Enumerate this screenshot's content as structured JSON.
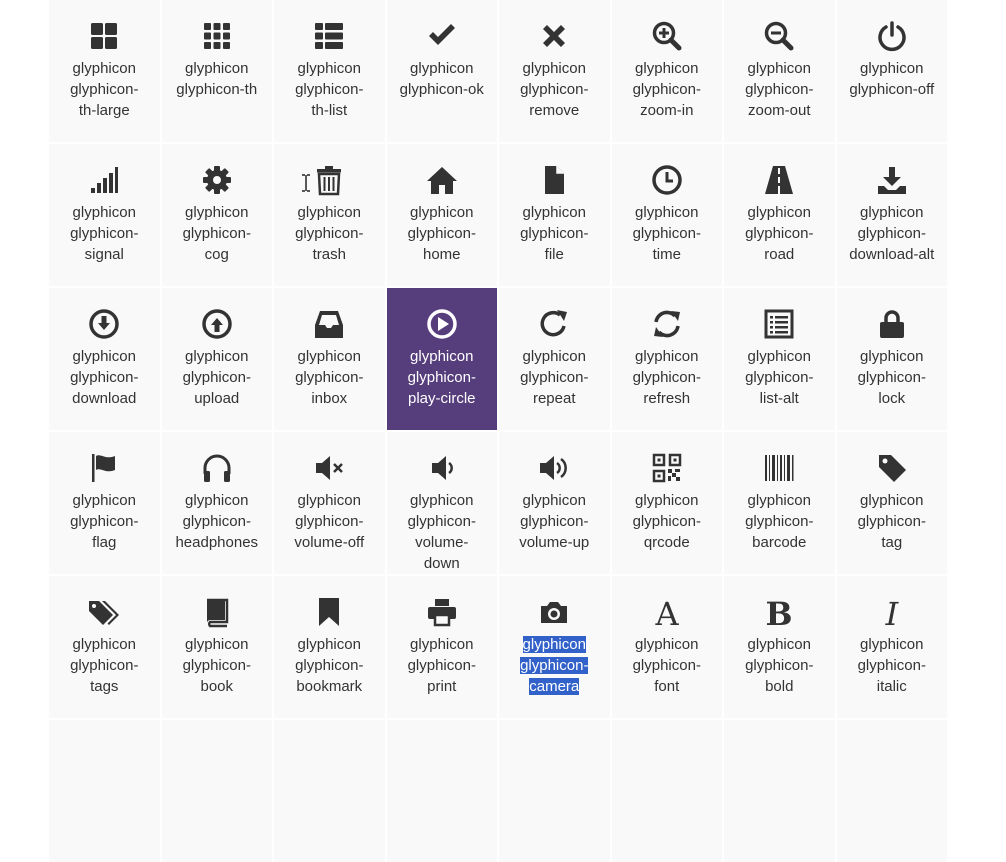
{
  "theme": {
    "cell_bg": "#f9f9f9",
    "text": "#333333",
    "active_bg": "#563d7c",
    "selection_bg": "#3161c9"
  },
  "icons": [
    {
      "icon": "th-large-icon",
      "line1": "glyphicon",
      "line2": "glyphicon-",
      "line3": "th-large"
    },
    {
      "icon": "th-icon",
      "line1": "glyphicon",
      "line2": "glyphicon-th",
      "line3": ""
    },
    {
      "icon": "th-list-icon",
      "line1": "glyphicon",
      "line2": "glyphicon-",
      "line3": "th-list"
    },
    {
      "icon": "ok-icon",
      "line1": "glyphicon",
      "line2": "glyphicon-ok",
      "line3": ""
    },
    {
      "icon": "remove-icon",
      "line1": "glyphicon",
      "line2": "glyphicon-",
      "line3": "remove"
    },
    {
      "icon": "zoom-in-icon",
      "line1": "glyphicon",
      "line2": "glyphicon-",
      "line3": "zoom-in"
    },
    {
      "icon": "zoom-out-icon",
      "line1": "glyphicon",
      "line2": "glyphicon-",
      "line3": "zoom-out"
    },
    {
      "icon": "off-icon",
      "line1": "glyphicon",
      "line2": "glyphicon-off",
      "line3": ""
    },
    {
      "icon": "signal-icon",
      "line1": "glyphicon",
      "line2": "glyphicon-",
      "line3": "signal"
    },
    {
      "icon": "cog-icon",
      "line1": "glyphicon",
      "line2": "glyphicon-",
      "line3": "cog"
    },
    {
      "icon": "trash-icon",
      "line1": "glyphicon",
      "line2": "glyphicon-",
      "line3": "trash"
    },
    {
      "icon": "home-icon",
      "line1": "glyphicon",
      "line2": "glyphicon-",
      "line3": "home"
    },
    {
      "icon": "file-icon",
      "line1": "glyphicon",
      "line2": "glyphicon-",
      "line3": "file"
    },
    {
      "icon": "time-icon",
      "line1": "glyphicon",
      "line2": "glyphicon-",
      "line3": "time"
    },
    {
      "icon": "road-icon",
      "line1": "glyphicon",
      "line2": "glyphicon-",
      "line3": "road"
    },
    {
      "icon": "download-alt-icon",
      "line1": "glyphicon",
      "line2": "glyphicon-",
      "line3": "download-alt"
    },
    {
      "icon": "download-icon",
      "line1": "glyphicon",
      "line2": "glyphicon-",
      "line3": "download"
    },
    {
      "icon": "upload-icon",
      "line1": "glyphicon",
      "line2": "glyphicon-",
      "line3": "upload"
    },
    {
      "icon": "inbox-icon",
      "line1": "glyphicon",
      "line2": "glyphicon-",
      "line3": "inbox"
    },
    {
      "icon": "play-circle-icon",
      "line1": "glyphicon",
      "line2": "glyphicon-",
      "line3": "play-circle"
    },
    {
      "icon": "repeat-icon",
      "line1": "glyphicon",
      "line2": "glyphicon-",
      "line3": "repeat"
    },
    {
      "icon": "refresh-icon",
      "line1": "glyphicon",
      "line2": "glyphicon-",
      "line3": "refresh"
    },
    {
      "icon": "list-alt-icon",
      "line1": "glyphicon",
      "line2": "glyphicon-",
      "line3": "list-alt"
    },
    {
      "icon": "lock-icon",
      "line1": "glyphicon",
      "line2": "glyphicon-",
      "line3": "lock"
    },
    {
      "icon": "flag-icon",
      "line1": "glyphicon",
      "line2": "glyphicon-",
      "line3": "flag"
    },
    {
      "icon": "headphones-icon",
      "line1": "glyphicon",
      "line2": "glyphicon-",
      "line3": "headphones"
    },
    {
      "icon": "volume-off-icon",
      "line1": "glyphicon",
      "line2": "glyphicon-",
      "line3": "volume-off"
    },
    {
      "icon": "volume-down-icon",
      "line1": "glyphicon",
      "line2": "glyphicon-",
      "line3": "volume-",
      "line4": "down"
    },
    {
      "icon": "volume-up-icon",
      "line1": "glyphicon",
      "line2": "glyphicon-",
      "line3": "volume-up"
    },
    {
      "icon": "qrcode-icon",
      "line1": "glyphicon",
      "line2": "glyphicon-",
      "line3": "qrcode"
    },
    {
      "icon": "barcode-icon",
      "line1": "glyphicon",
      "line2": "glyphicon-",
      "line3": "barcode"
    },
    {
      "icon": "tag-icon",
      "line1": "glyphicon",
      "line2": "glyphicon-",
      "line3": "tag"
    },
    {
      "icon": "tags-icon",
      "line1": "glyphicon",
      "line2": "glyphicon-",
      "line3": "tags"
    },
    {
      "icon": "book-icon",
      "line1": "glyphicon",
      "line2": "glyphicon-",
      "line3": "book"
    },
    {
      "icon": "bookmark-icon",
      "line1": "glyphicon",
      "line2": "glyphicon-",
      "line3": "bookmark"
    },
    {
      "icon": "print-icon",
      "line1": "glyphicon",
      "line2": "glyphicon-",
      "line3": "print"
    },
    {
      "icon": "camera-icon",
      "line1": "glyphicon",
      "line2": "glyphicon-",
      "line3": "camera"
    },
    {
      "icon": "font-icon",
      "line1": "glyphicon",
      "line2": "glyphicon-",
      "line3": "font"
    },
    {
      "icon": "bold-icon",
      "line1": "glyphicon",
      "line2": "glyphicon-",
      "line3": "bold"
    },
    {
      "icon": "italic-icon",
      "line1": "glyphicon",
      "line2": "glyphicon-",
      "line3": "italic"
    },
    {
      "icon": "",
      "line1": "",
      "line2": "",
      "line3": ""
    },
    {
      "icon": "",
      "line1": "",
      "line2": "",
      "line3": ""
    },
    {
      "icon": "",
      "line1": "",
      "line2": "",
      "line3": ""
    },
    {
      "icon": "",
      "line1": "",
      "line2": "",
      "line3": ""
    },
    {
      "icon": "",
      "line1": "",
      "line2": "",
      "line3": ""
    },
    {
      "icon": "",
      "line1": "",
      "line2": "",
      "line3": ""
    },
    {
      "icon": "",
      "line1": "",
      "line2": "",
      "line3": ""
    },
    {
      "icon": "",
      "line1": "",
      "line2": "",
      "line3": ""
    }
  ],
  "state": {
    "active_item": "play-circle-icon",
    "text_selected_item": "camera-icon"
  }
}
